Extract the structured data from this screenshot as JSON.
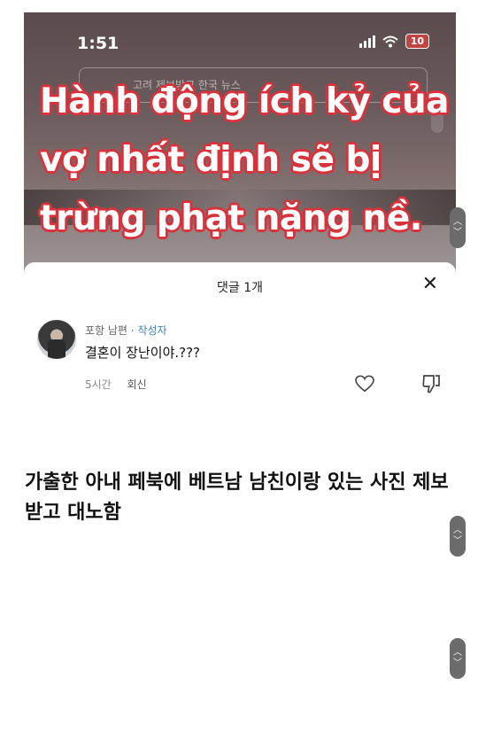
{
  "status_bar": {
    "time": "1:51",
    "battery": "10"
  },
  "video": {
    "ghost_text": "고려 제보받고 한국 뉴스",
    "caption_lines": [
      "Hành động ích kỷ của",
      "vợ nhất định sẽ bị",
      "trừng phạt nặng nề."
    ]
  },
  "comments": {
    "title": "댓글 1개",
    "close": "✕",
    "items": [
      {
        "author": "포항 남편",
        "separator": " · ",
        "badge": "작성자",
        "text": "결혼이 장난이야.???",
        "time": "5시간",
        "reply": "회신"
      }
    ]
  },
  "headline": "가출한 아내 페북에 베트남 남친이랑 있는 사진 제보받고 대노함",
  "icons": [
    "signal-icon",
    "wifi-icon",
    "battery-icon",
    "close-icon",
    "heart-icon",
    "dislike-icon",
    "chevron-up-icon",
    "chevron-down-icon"
  ]
}
